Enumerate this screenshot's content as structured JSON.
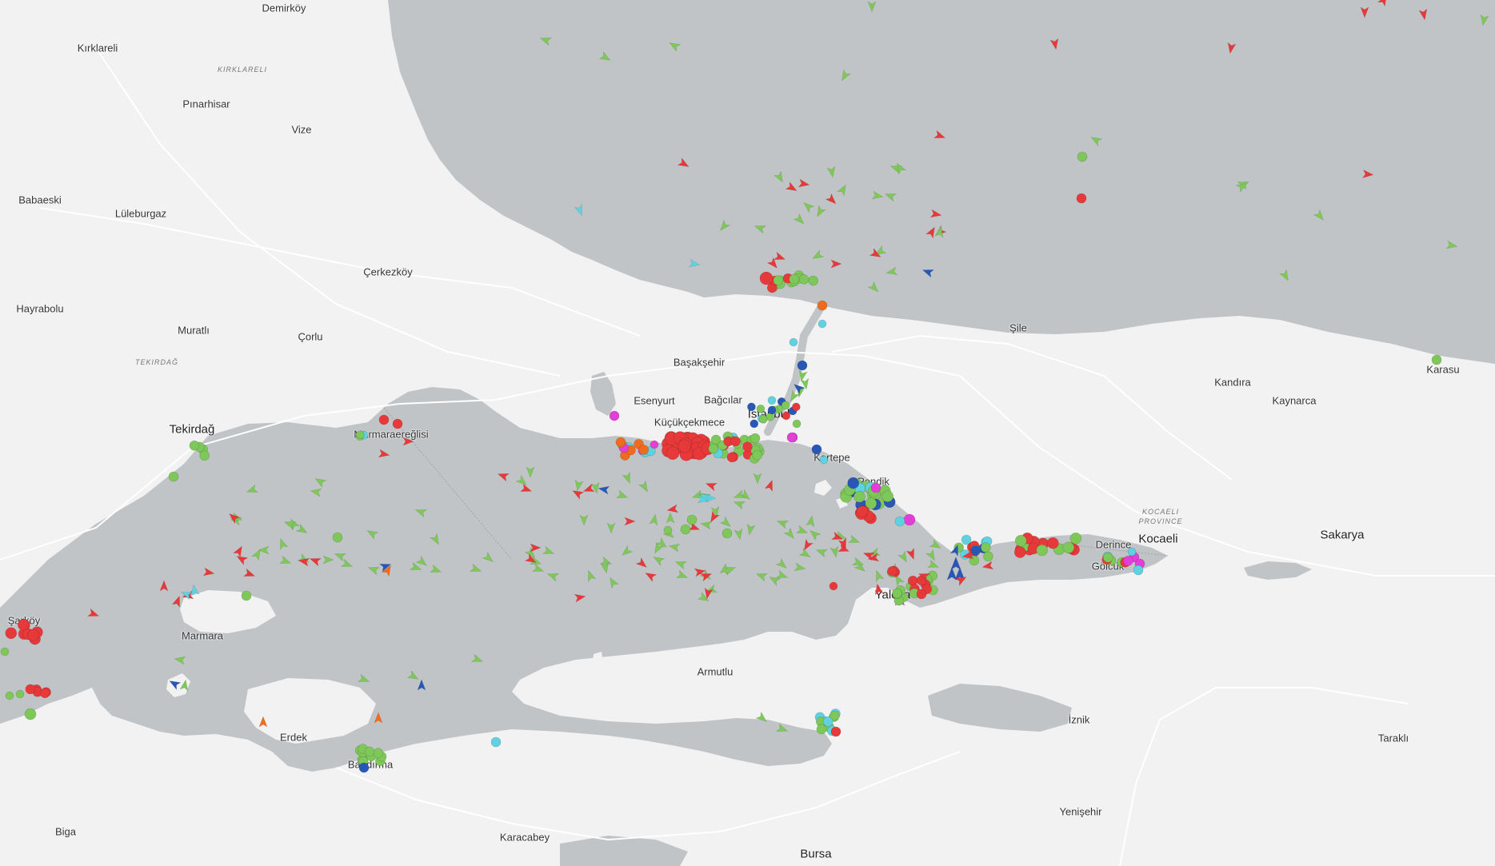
{
  "map": {
    "colors": {
      "land": "#f2f2f2",
      "water": "#c1c4c7",
      "roads": "#ffffff",
      "land_shade": "#e8e8e8",
      "cargo": "#7ec85a",
      "tanker": "#e8393a",
      "passenger": "#2857b8",
      "fishing": "#5fd1e0",
      "special": "#ef6c1e",
      "pleasure": "#e13fd6"
    },
    "place_labels": [
      {
        "name": "Demirköy",
        "kind": "city"
      },
      {
        "name": "Kırklareli",
        "kind": "city"
      },
      {
        "name": "KIRKLARELI",
        "kind": "region"
      },
      {
        "name": "Pınarhisar",
        "kind": "city"
      },
      {
        "name": "Vize",
        "kind": "city"
      },
      {
        "name": "Babaeski",
        "kind": "city"
      },
      {
        "name": "Lüleburgaz",
        "kind": "city"
      },
      {
        "name": "Çerkezköy",
        "kind": "city"
      },
      {
        "name": "Hayrabolu",
        "kind": "city"
      },
      {
        "name": "Muratlı",
        "kind": "city"
      },
      {
        "name": "Çorlu",
        "kind": "city"
      },
      {
        "name": "TEKIRDAĞ",
        "kind": "region"
      },
      {
        "name": "Tekirdağ",
        "kind": "bigcity"
      },
      {
        "name": "Marmaraereğlisi",
        "kind": "city"
      },
      {
        "name": "Başakşehir",
        "kind": "city"
      },
      {
        "name": "Esenyurt",
        "kind": "city"
      },
      {
        "name": "Bağcılar",
        "kind": "city"
      },
      {
        "name": "Küçükçekmece",
        "kind": "city"
      },
      {
        "name": "İstanbul",
        "kind": "bigcity"
      },
      {
        "name": "Kartepe",
        "kind": "city"
      },
      {
        "name": "Pendik",
        "kind": "city"
      },
      {
        "name": "Şile",
        "kind": "city"
      },
      {
        "name": "Kandıra",
        "kind": "city"
      },
      {
        "name": "Kaynarca",
        "kind": "city"
      },
      {
        "name": "Karasu",
        "kind": "city"
      },
      {
        "name": "KOCAELI",
        "kind": "region"
      },
      {
        "name": "PROVINCE",
        "kind": "region"
      },
      {
        "name": "Kocaeli",
        "kind": "bigcity"
      },
      {
        "name": "Derince",
        "kind": "city"
      },
      {
        "name": "Gölcük",
        "kind": "city"
      },
      {
        "name": "Sakarya",
        "kind": "bigcity"
      },
      {
        "name": "Yalova",
        "kind": "bigcity"
      },
      {
        "name": "Şarköy",
        "kind": "city"
      },
      {
        "name": "Marmara",
        "kind": "city"
      },
      {
        "name": "Armutlu",
        "kind": "city"
      },
      {
        "name": "Erdek",
        "kind": "city"
      },
      {
        "name": "Bandırma",
        "kind": "city"
      },
      {
        "name": "Biga",
        "kind": "city"
      },
      {
        "name": "Karacabey",
        "kind": "city"
      },
      {
        "name": "Bursa",
        "kind": "bigcity"
      },
      {
        "name": "Yenişehir",
        "kind": "city"
      },
      {
        "name": "İznik",
        "kind": "city"
      },
      {
        "name": "Taraklı",
        "kind": "city"
      }
    ]
  }
}
